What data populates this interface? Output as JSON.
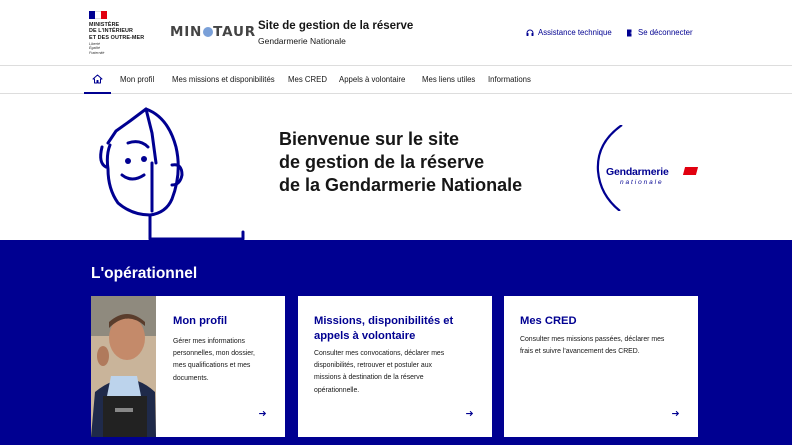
{
  "header": {
    "ministry": [
      "MINISTÈRE",
      "DE L'INTÉRIEUR",
      "ET DES OUTRE-MER"
    ],
    "motto": [
      "Liberté",
      "Égalité",
      "Fraternité"
    ],
    "app_logo_text": [
      "MIN",
      "TAUR"
    ],
    "site_title": "Site de gestion de la réserve",
    "site_subtitle": "Gendarmerie Nationale",
    "assistance_label": "Assistance technique",
    "logout_label": "Se déconnecter"
  },
  "nav": {
    "items": [
      {
        "label": "Mon profil"
      },
      {
        "label": "Mes missions et disponibilités"
      },
      {
        "label": "Mes CRED"
      },
      {
        "label": "Appels à volontaire"
      },
      {
        "label": "Mes liens utiles"
      },
      {
        "label": "Informations"
      }
    ]
  },
  "hero": {
    "lines": [
      "Bienvenue sur le site",
      "de gestion de la réserve",
      "de la Gendarmerie Nationale"
    ],
    "logo_text": [
      "Gendarmerie",
      "nationale"
    ]
  },
  "ops": {
    "title": "L'opérationnel",
    "cards": [
      {
        "title": [
          "Mon profil"
        ],
        "desc": [
          "Gérer mes informations",
          "personnelles, mon dossier,",
          "mes qualifications et mes",
          "documents."
        ]
      },
      {
        "title": [
          "Missions, disponibilités et",
          "appels à volontaire"
        ],
        "desc": [
          "Consulter mes convocations, déclarer mes",
          "disponibilités, retrouver et postuler aux",
          "missions à destination de la réserve",
          "opérationnelle."
        ]
      },
      {
        "title": [
          "Mes CRED"
        ],
        "desc": [
          "Consulter mes missions passées, déclarer mes",
          "frais et suivre l'avancement des CRED."
        ]
      }
    ]
  },
  "colors": {
    "primary": "#000091",
    "flag_red": "#e1000f"
  }
}
